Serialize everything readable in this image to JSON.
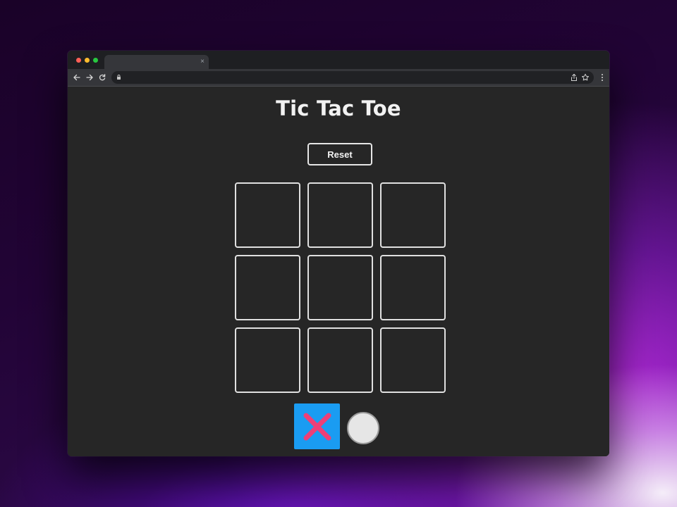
{
  "browser": {
    "tab_close_glyph": "×",
    "icons": {
      "back": "arrow-left-icon",
      "forward": "arrow-right-icon",
      "reload": "reload-icon",
      "lock": "lock-icon",
      "share": "share-icon",
      "bookmark": "star-icon",
      "menu": "more-vert-icon"
    }
  },
  "game": {
    "title": "Tic Tac Toe",
    "reset_label": "Reset",
    "board": [
      [
        "",
        "",
        ""
      ],
      [
        "",
        "",
        ""
      ],
      [
        "",
        "",
        ""
      ]
    ],
    "players": [
      {
        "symbol": "X",
        "icon": "x-mark-icon",
        "selected": true
      },
      {
        "symbol": "O",
        "icon": "circle-icon",
        "selected": false
      }
    ]
  },
  "colors": {
    "page_background": "#262626",
    "cell_border": "#e0e0e0",
    "x_tile_background": "#1a9cf2",
    "x_mark": "#ee3f78",
    "o_fill": "#e6e6e6",
    "text": "#f2f2f2"
  }
}
